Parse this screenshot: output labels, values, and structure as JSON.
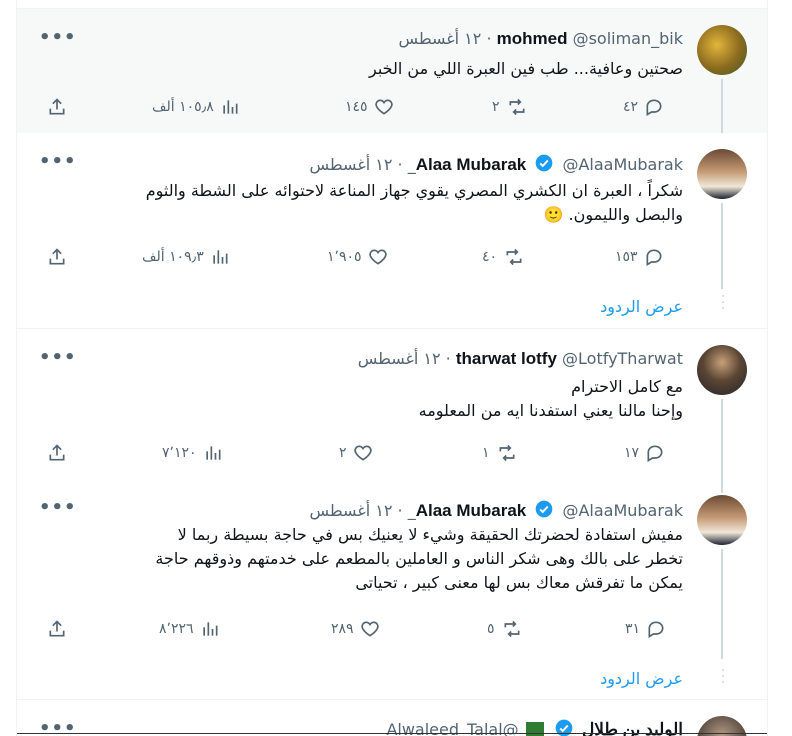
{
  "tweets": [
    {
      "name": "mohmed",
      "handle": "@soliman_bik",
      "time": "١٢ أغسطس",
      "text": "صحتين وعافية... طب فين العبرة اللي من الخبر",
      "replies": "٤٢",
      "retweets": "٢",
      "likes": "١٤٥",
      "views": "١٠٥٫٨ ألف",
      "verified": false
    },
    {
      "name": "Alaa Mubarak",
      "handle": "@AlaaMubarak_",
      "time": "١٢ أغسطس",
      "text_lines": [
        "شكراً ، العبرة ان الكشري المصري يقوي جهاز المناعة لاحتوائه على الشطة والثوم",
        "والبصل والليمون. 🙂"
      ],
      "replies": "١٥٣",
      "retweets": "٤٠",
      "likes": "١٬٩٠٥",
      "views": "١٠٩٫٣ ألف",
      "verified": true
    },
    {
      "name": "tharwat lotfy",
      "handle": "@LotfyTharwat",
      "time": "١٢ أغسطس",
      "text_lines": [
        "مع كامل الاحترام",
        "وإحنا مالنا يعني استفدنا ايه من المعلومه"
      ],
      "replies": "١٧",
      "retweets": "١",
      "likes": "٢",
      "views": "٧٬١٢٠",
      "verified": false
    },
    {
      "name": "Alaa Mubarak",
      "handle": "@AlaaMubarak_",
      "time": "١٢ أغسطس",
      "text_lines": [
        "مفيش استفادة لحضرتك الحقيقة وشيء لا يعنيك بس في حاجة بسيطة ربما لا",
        "تخطر على بالك وهى شكر الناس و العاملين بالمطعم على خدمتهم وذوقهم حاجة",
        "يمكن ما تفرقش معاك بس لها معنى كبير ، تحياتى"
      ],
      "replies": "٣١",
      "retweets": "٥",
      "likes": "٢٨٩",
      "views": "٨٬٢٢٦",
      "verified": true
    },
    {
      "name": "الوليد بن طلال",
      "handle": "@Alwaleed_Talal",
      "verified": true
    }
  ],
  "show_replies": "عرض الردود",
  "separator": "·",
  "more_icon": "more-horizontal-icon",
  "colors": {
    "accent": "#1d9bf0",
    "muted": "#536471",
    "highlight_bg": "#f7f9f9"
  }
}
